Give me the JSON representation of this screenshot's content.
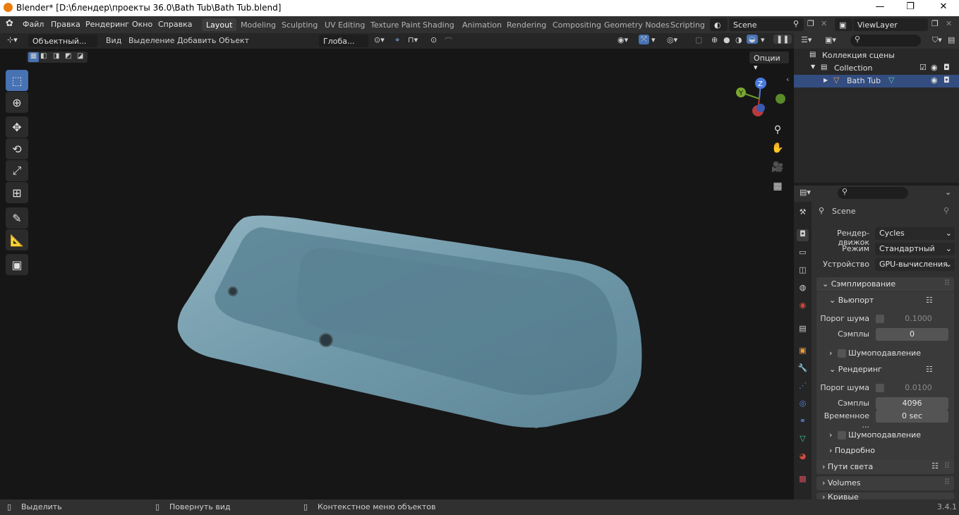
{
  "window": {
    "title": "Blender* [D:\\блендер\\проекты 36.0\\Bath Tub\\Bath Tub.blend]",
    "minimize": "—",
    "maximize": "❐",
    "close": "✕"
  },
  "menu": [
    "Файл",
    "Правка",
    "Рендеринг",
    "Окно",
    "Справка"
  ],
  "workspace_tabs": [
    "Layout",
    "Modeling",
    "Sculpting",
    "UV Editing",
    "Texture Paint",
    "Shading",
    "Animation",
    "Rendering",
    "Compositing",
    "Geometry Nodes",
    "Scripting"
  ],
  "active_workspace": "Layout",
  "scene_field": "Scene",
  "viewlayer_field": "ViewLayer",
  "viewport_header": {
    "mode": "Объектный...",
    "menus": [
      "Вид",
      "Выделение",
      "Добавить",
      "Объект"
    ],
    "orientation": "Глоба...",
    "options": "Опции"
  },
  "gizmo": {
    "z": "Z",
    "y": "Y"
  },
  "outliner": {
    "scene_collection": "Коллекция сцены",
    "collection": "Collection",
    "object": "Bath Tub"
  },
  "properties": {
    "scene": "Scene",
    "render_engine_label": "Рендер-движок",
    "render_engine": "Cycles",
    "mode_label": "Режим",
    "mode": "Стандартный",
    "device_label": "Устройство",
    "device": "GPU-вычисления",
    "sampling": "Сэмплирование",
    "viewport": "Вьюпорт",
    "noise_threshold_label": "Порог шума",
    "viewport_noise": "0.1000",
    "samples_label": "Сэмплы",
    "viewport_samples": "0",
    "denoise_label": "Шумоподавление",
    "render": "Рендеринг",
    "render_noise": "0.0100",
    "render_samples": "4096",
    "time_label": "Временное ...",
    "time_value": "0 sec",
    "advanced": "Подробно",
    "light_paths": "Пути света",
    "volumes": "Volumes",
    "curves": "Кривые"
  },
  "status": {
    "select": "Выделить",
    "rotate": "Повернуть вид",
    "context": "Контекстное меню объектов",
    "version": "3.4.1"
  }
}
